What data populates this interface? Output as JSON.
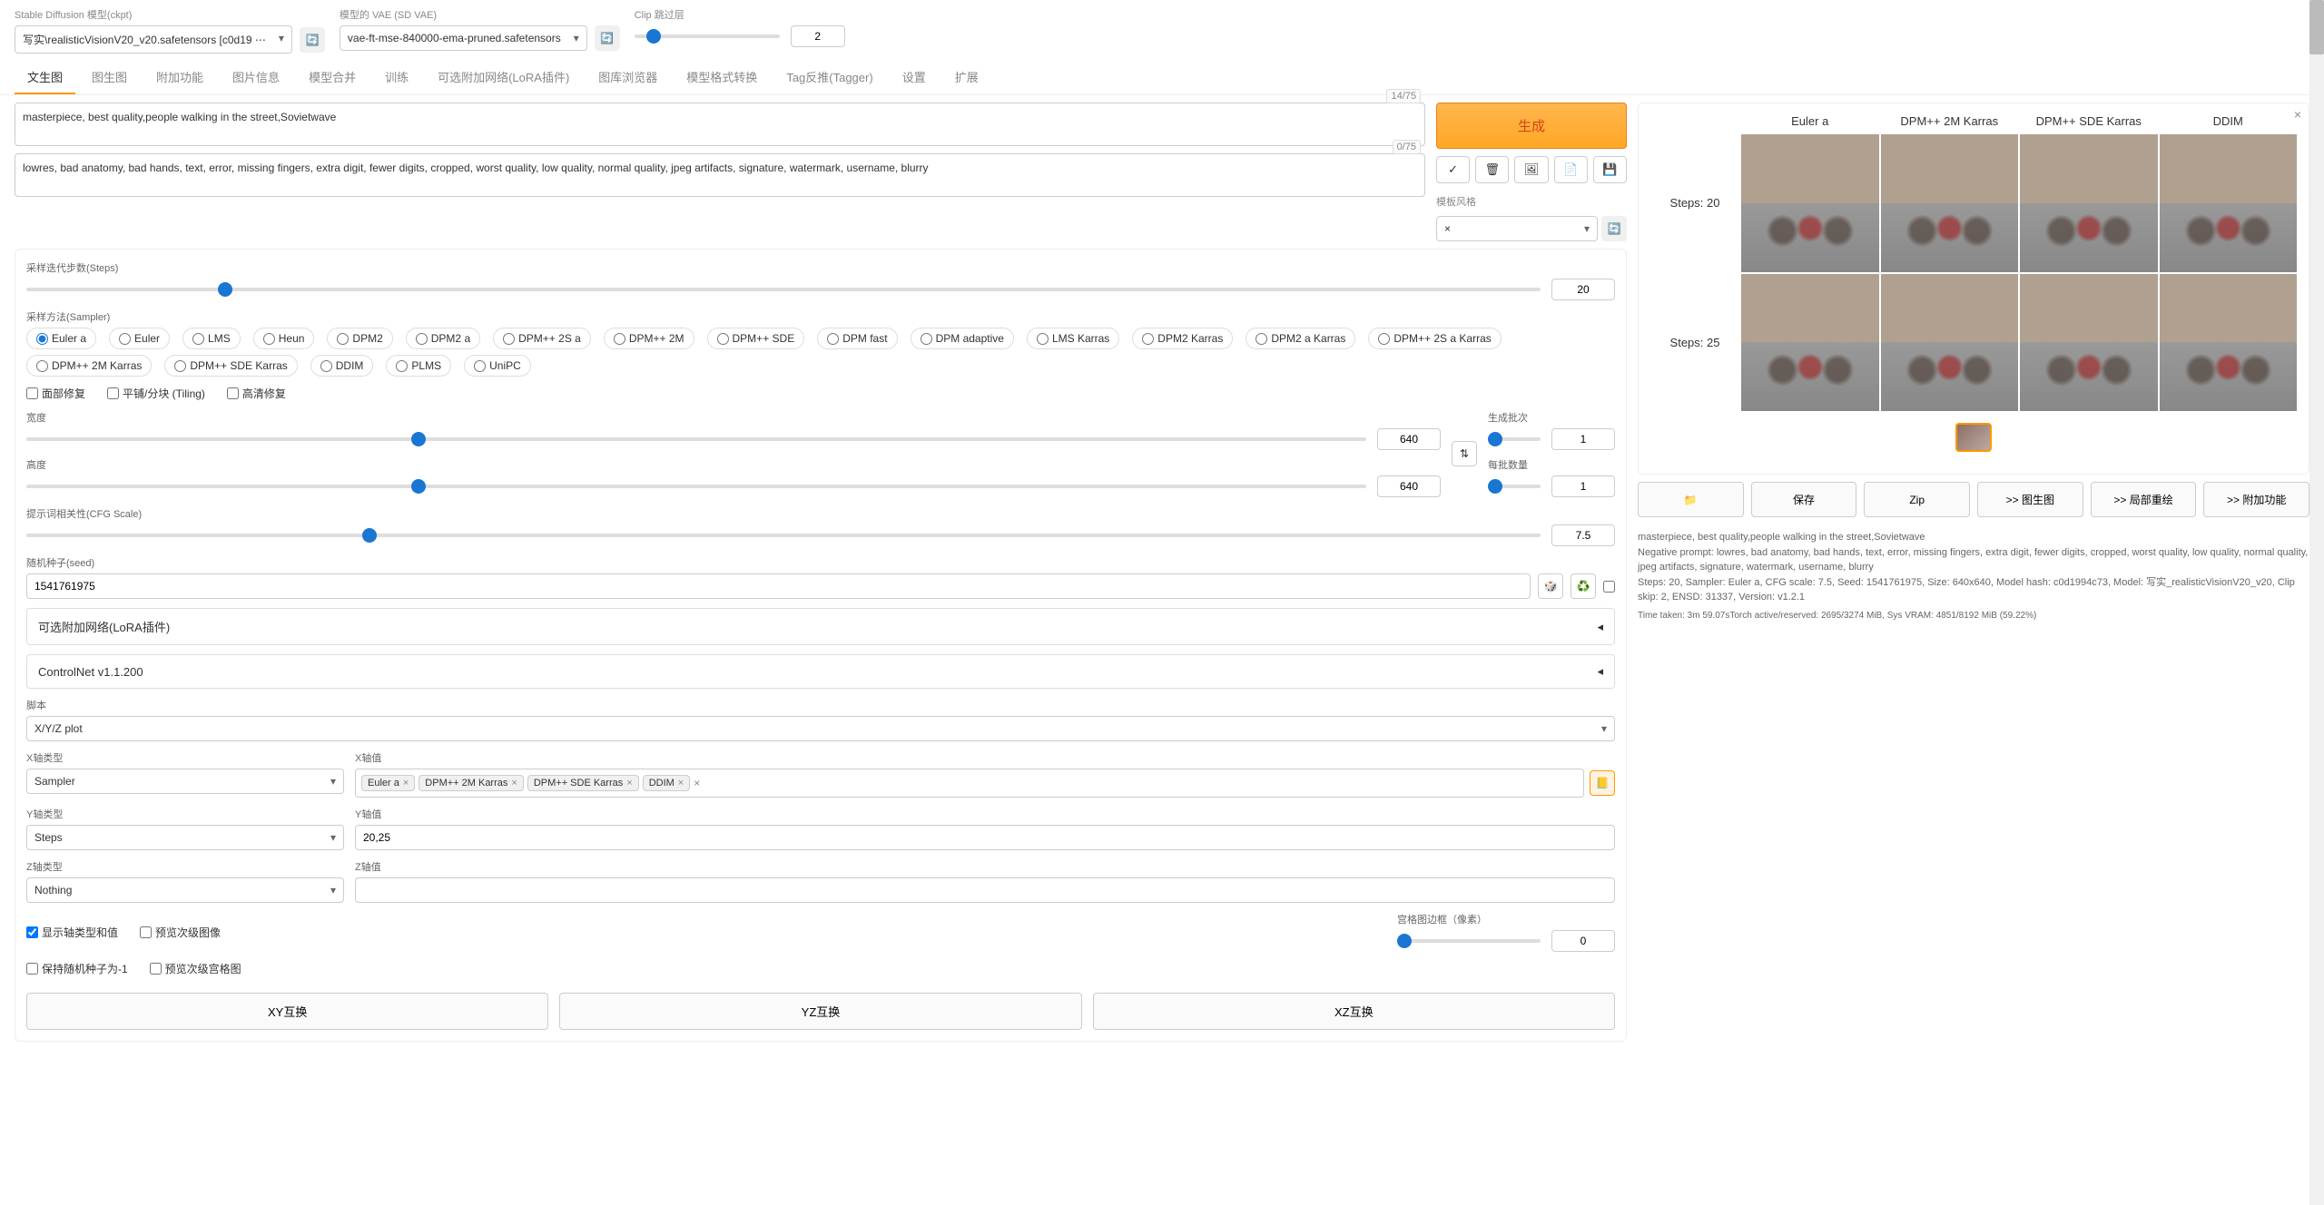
{
  "header": {
    "model_label": "Stable Diffusion 模型(ckpt)",
    "model_value": "写实\\realisticVisionV20_v20.safetensors [c0d19 ⋯",
    "vae_label": "模型的 VAE (SD VAE)",
    "vae_value": "vae-ft-mse-840000-ema-pruned.safetensors",
    "clip_label": "Clip 跳过层",
    "clip_value": "2"
  },
  "tabs": [
    "文生图",
    "图生图",
    "附加功能",
    "图片信息",
    "模型合并",
    "训练",
    "可选附加网络(LoRA插件)",
    "图库浏览器",
    "模型格式转换",
    "Tag反推(Tagger)",
    "设置",
    "扩展"
  ],
  "prompt": {
    "positive": "masterpiece, best quality,people walking in the street,Sovietwave",
    "positive_count": "14/75",
    "negative": "lowres, bad anatomy, bad hands, text, error, missing fingers, extra digit, fewer digits, cropped, worst quality, low quality, normal quality, jpeg artifacts, signature, watermark, username, blurry",
    "negative_count": "0/75"
  },
  "generate": {
    "label": "生成",
    "icons": [
      "✓",
      "🗑",
      "🖼",
      "📄",
      "💾"
    ],
    "style_label": "模板风格",
    "style_x": "×"
  },
  "settings": {
    "steps_label": "采样迭代步数(Steps)",
    "steps": "20",
    "sampler_label": "采样方法(Sampler)",
    "samplers": [
      "Euler a",
      "Euler",
      "LMS",
      "Heun",
      "DPM2",
      "DPM2 a",
      "DPM++ 2S a",
      "DPM++ 2M",
      "DPM++ SDE",
      "DPM fast",
      "DPM adaptive",
      "LMS Karras",
      "DPM2 Karras",
      "DPM2 a Karras",
      "DPM++ 2S a Karras",
      "DPM++ 2M Karras",
      "DPM++ SDE Karras",
      "DDIM",
      "PLMS",
      "UniPC"
    ],
    "checks": {
      "face": "面部修复",
      "tiling": "平铺/分块 (Tiling)",
      "hires": "高清修复"
    },
    "width_label": "宽度",
    "width": "640",
    "height_label": "高度",
    "height": "640",
    "batch_count_label": "生成批次",
    "batch_count": "1",
    "batch_size_label": "每批数量",
    "batch_size": "1",
    "cfg_label": "提示词相关性(CFG Scale)",
    "cfg": "7.5",
    "seed_label": "随机种子(seed)",
    "seed": "1541761975",
    "lora_label": "可选附加网络(LoRA插件)",
    "controlnet_label": "ControlNet v1.1.200",
    "script_label": "脚本",
    "script_value": "X/Y/Z plot"
  },
  "xyz": {
    "x_type_label": "X轴类型",
    "x_type": "Sampler",
    "x_val_label": "X轴值",
    "x_tags": [
      "Euler a",
      "DPM++ 2M Karras",
      "DPM++ SDE Karras",
      "DDIM"
    ],
    "y_type_label": "Y轴类型",
    "y_type": "Steps",
    "y_val_label": "Y轴值",
    "y_val": "20,25",
    "z_type_label": "Z轴类型",
    "z_type": "Nothing",
    "z_val_label": "Z轴值",
    "check_legend": "显示轴类型和值",
    "check_subgrid": "预览次级图像",
    "check_seed": "保持随机种子为-1",
    "check_subgrid2": "预览次级宫格图",
    "margin_label": "宫格图边框（像素）",
    "margin": "0",
    "swap_xy": "XY互换",
    "swap_yz": "YZ互换",
    "swap_xz": "XZ互换"
  },
  "output": {
    "cols": [
      "Euler a",
      "DPM++ 2M Karras",
      "DPM++ SDE Karras",
      "DDIM"
    ],
    "rows": [
      "Steps: 20",
      "Steps: 25"
    ],
    "folder": "📁",
    "save": "保存",
    "zip": "Zip",
    "img2img": ">> 图生图",
    "inpaint": ">> 局部重绘",
    "extras": ">> 附加功能",
    "info1": "masterpiece, best quality,people walking in the street,Sovietwave",
    "info2": "Negative prompt: lowres, bad anatomy, bad hands, text, error, missing fingers, extra digit, fewer digits, cropped, worst quality, low quality, normal quality, jpeg artifacts, signature, watermark, username, blurry",
    "info3": "Steps: 20, Sampler: Euler a, CFG scale: 7.5, Seed: 1541761975, Size: 640x640, Model hash: c0d1994c73, Model: 写实_realisticVisionV20_v20, Clip skip: 2, ENSD: 31337, Version: v1.2.1",
    "info4": "Time taken: 3m 59.07sTorch active/reserved: 2695/3274 MiB, Sys VRAM: 4851/8192 MiB (59.22%)"
  },
  "chart_data": {
    "type": "table",
    "title": "X/Y/Z plot output grid",
    "x_axis": "Sampler",
    "y_axis": "Steps",
    "x_values": [
      "Euler a",
      "DPM++ 2M Karras",
      "DPM++ SDE Karras",
      "DDIM"
    ],
    "y_values": [
      20,
      25
    ]
  }
}
